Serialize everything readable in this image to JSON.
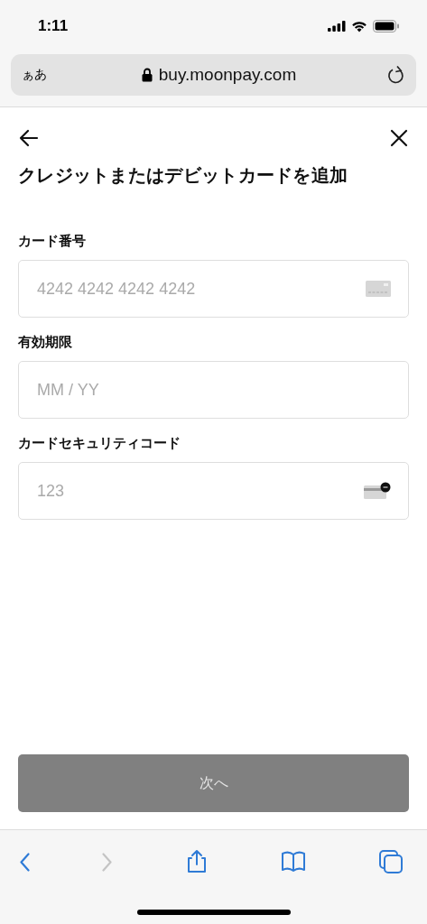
{
  "status_bar": {
    "time": "1:11"
  },
  "address_bar": {
    "text_size_button": "ぁあ",
    "url": "buy.moonpay.com"
  },
  "header": {
    "title": "クレジットまたはデビットカードを追加"
  },
  "fields": [
    {
      "label": "カード番号",
      "placeholder": "4242 4242 4242 4242",
      "kind": "card"
    },
    {
      "label": "有効期限",
      "placeholder": "MM / YY",
      "kind": "plain"
    },
    {
      "label": "カードセキュリティコード",
      "placeholder": "123",
      "kind": "cvv"
    }
  ],
  "next_button": {
    "label": "次へ",
    "disabled": true
  },
  "toolbar": [
    {
      "kind": "back",
      "disabled": false
    },
    {
      "kind": "forward",
      "disabled": true
    },
    {
      "kind": "share",
      "disabled": false
    },
    {
      "kind": "bookmarks",
      "disabled": false
    },
    {
      "kind": "tabs",
      "disabled": false
    }
  ]
}
